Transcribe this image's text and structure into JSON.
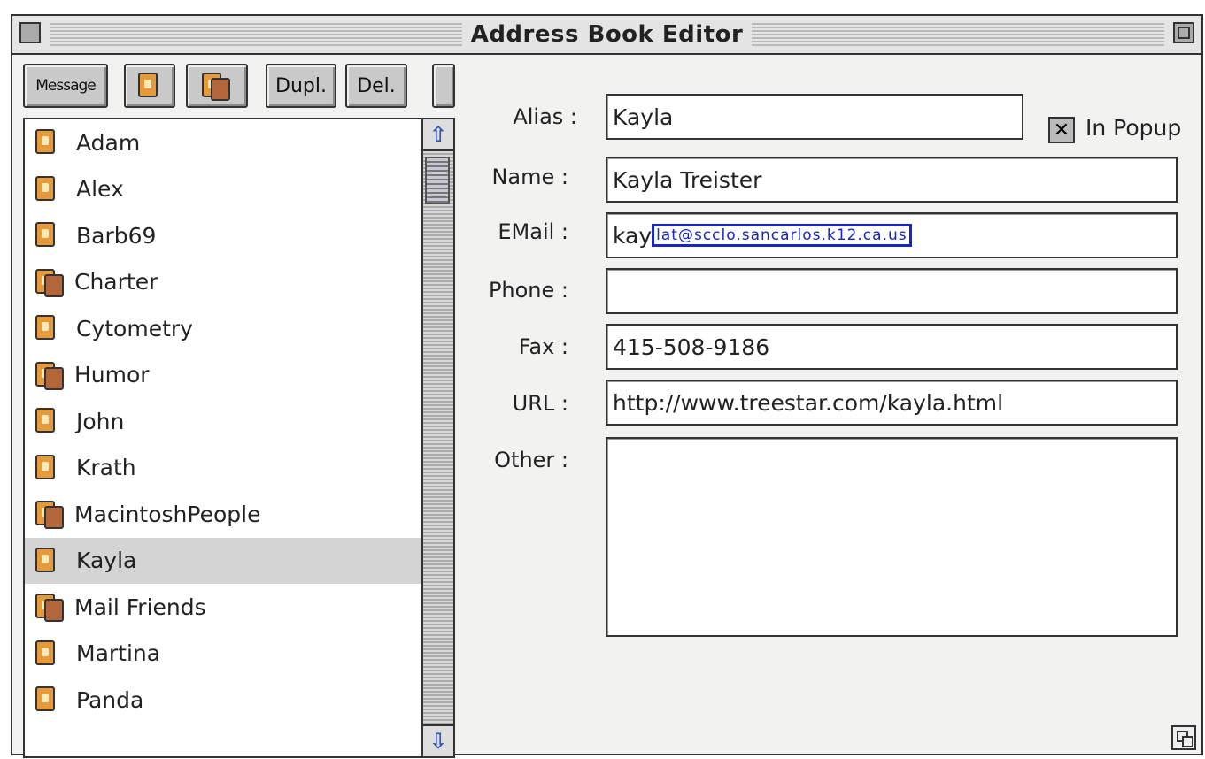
{
  "window": {
    "title": "Address Book Editor"
  },
  "toolbar": {
    "message_label": "Message",
    "dupl_label": "Dupl.",
    "del_label": "Del."
  },
  "contacts": [
    {
      "label": "Adam",
      "icon": "person-card-icon",
      "multi": false
    },
    {
      "label": "Alex",
      "icon": "person-card-icon",
      "multi": false
    },
    {
      "label": "Barb69",
      "icon": "person-card-icon",
      "multi": false
    },
    {
      "label": "Charter",
      "icon": "group-cards-icon",
      "multi": true
    },
    {
      "label": "Cytometry",
      "icon": "person-card-icon",
      "multi": false
    },
    {
      "label": "Humor",
      "icon": "group-cards-icon",
      "multi": true
    },
    {
      "label": "John",
      "icon": "person-card-icon",
      "multi": false
    },
    {
      "label": "Krath",
      "icon": "person-card-icon",
      "multi": false
    },
    {
      "label": "MacintoshPeople",
      "icon": "group-cards-icon",
      "multi": true
    },
    {
      "label": "Kayla",
      "icon": "person-card-icon",
      "multi": false,
      "selected": true
    },
    {
      "label": "Mail Friends",
      "icon": "group-cards-icon",
      "multi": true
    },
    {
      "label": "Martina",
      "icon": "person-card-icon",
      "multi": false
    },
    {
      "label": "Panda",
      "icon": "person-card-icon",
      "multi": false
    }
  ],
  "form": {
    "alias_label": "Alias :",
    "alias_value": "Kayla",
    "in_popup_label": "In Popup",
    "in_popup_checked": true,
    "name_label": "Name :",
    "name_value": "Kayla Treister",
    "email_label": "EMail :",
    "email_prefix": "kay",
    "email_selected": "lat@scclo.sancarlos.k12.ca.us",
    "phone_label": "Phone :",
    "phone_value": "",
    "fax_label": "Fax :",
    "fax_value": "415-508-9186",
    "url_label": "URL :",
    "url_value": "http://www.treestar.com/kayla.html",
    "other_label": "Other :",
    "other_value": ""
  },
  "colors": {
    "selection_outline": "#1727c9",
    "card_orange": "#e69a3c",
    "card_brown": "#b5673c"
  }
}
